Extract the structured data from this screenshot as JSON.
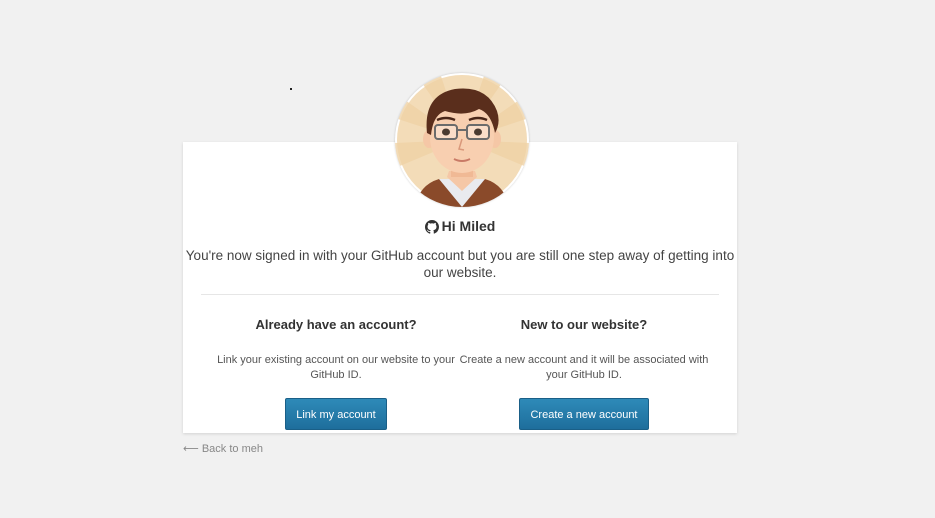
{
  "greeting": {
    "icon": "github-icon",
    "text": "Hi Miled"
  },
  "message": "You're now signed in with your GitHub account but you are still one step away of getting into our website.",
  "existing_account": {
    "heading": "Already have an account?",
    "description": "Link your existing account on our website to your GitHub ID.",
    "button_label": "Link my account"
  },
  "new_account": {
    "heading": "New to our website?",
    "description": "Create a new account and it will be associated with your GitHub ID.",
    "button_label": "Create a new account"
  },
  "back_link": "⟵ Back to meh",
  "colors": {
    "background": "#f1f1f1",
    "card": "#ffffff",
    "button": "#2683b3",
    "avatar_bg": "#f3dcb8"
  }
}
